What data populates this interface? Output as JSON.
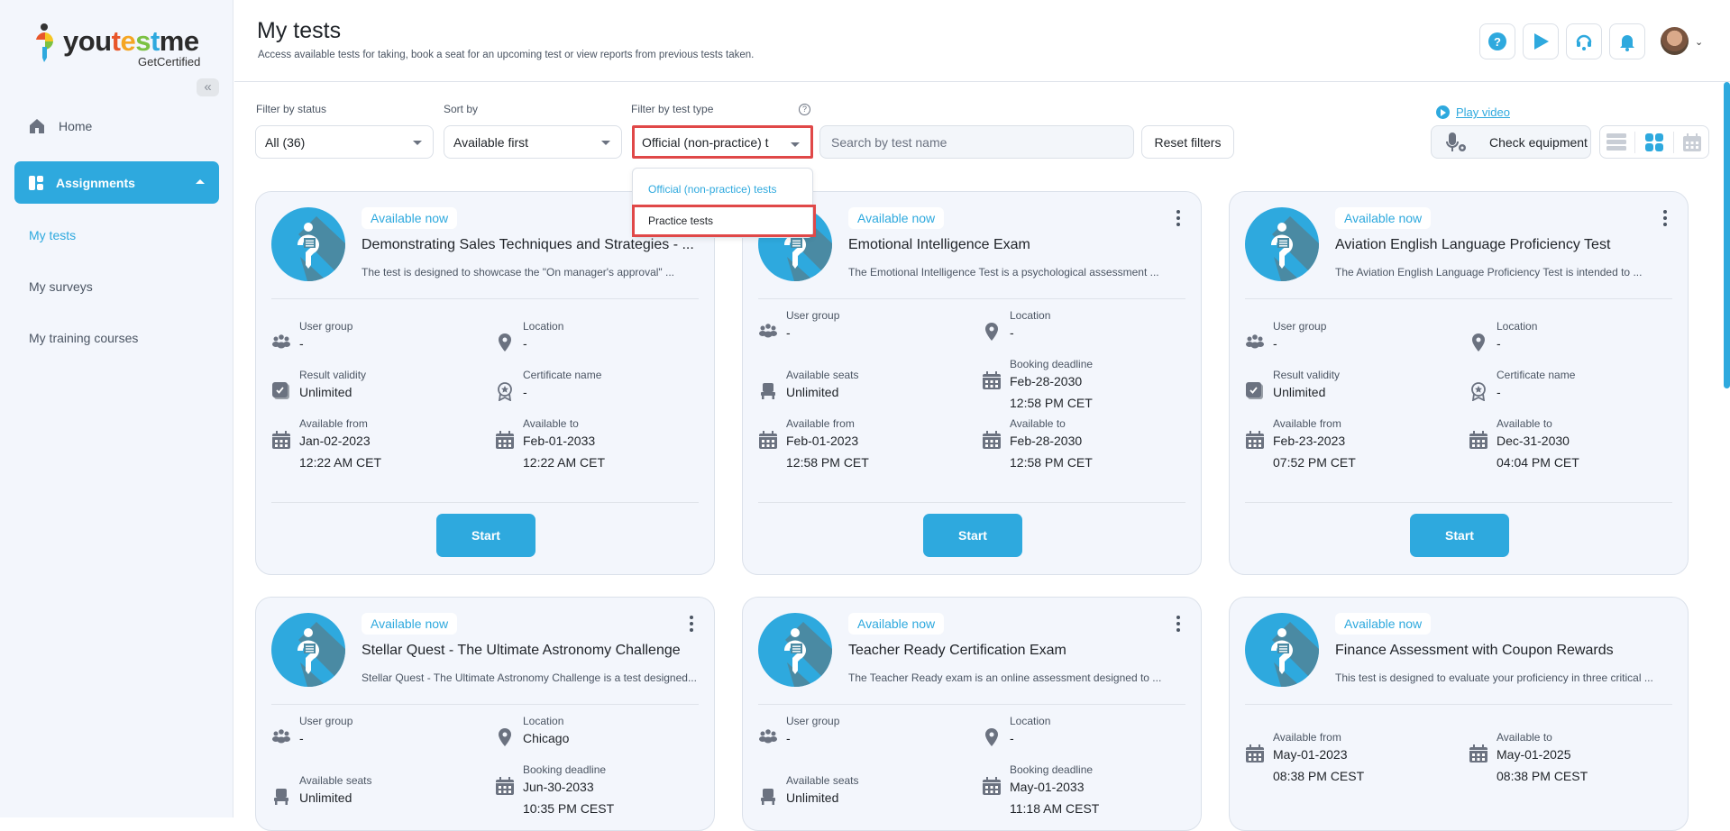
{
  "brand": {
    "word_parts": [
      "you",
      "t",
      "e",
      "s",
      "t",
      "me"
    ],
    "sub": "GetCertified",
    "accent": "#2ea9de",
    "highlight": "#e04848"
  },
  "sidebar": {
    "collapse_icon": "double-chevron-left-icon",
    "home_label": "Home",
    "assignments_label": "Assignments",
    "items": [
      {
        "label": "My tests",
        "active": true
      },
      {
        "label": "My surveys",
        "active": false
      },
      {
        "label": "My training courses",
        "active": false
      }
    ]
  },
  "header": {
    "title": "My tests",
    "subtitle": "Access available tests for taking, book a seat for an upcoming test or view reports from previous tests taken.",
    "icons": [
      "help-icon",
      "play-icon",
      "headset-icon",
      "bell-icon"
    ],
    "user_menu_caret": "⌄"
  },
  "filters": {
    "status_label": "Filter by status",
    "status_value": "All (36)",
    "sort_label": "Sort by",
    "sort_value": "Available first",
    "type_label": "Filter by test type",
    "type_help": "?",
    "type_value": "Official (non-practice) t",
    "type_options": [
      "Official (non-practice) tests",
      "Practice tests"
    ],
    "search_placeholder": "Search by test name",
    "reset_label": "Reset filters",
    "play_video_label": "Play video",
    "check_equipment_label": "Check equipment",
    "views": [
      "list-view",
      "grid-view",
      "calendar-view"
    ],
    "active_view": "grid-view"
  },
  "cards": [
    {
      "badge": "Available now",
      "title": "Demonstrating Sales Techniques and Strategies - ...",
      "desc": "The test is designed to showcase the \"On manager's approval\" ...",
      "fields": [
        {
          "icon": "users",
          "label": "User group",
          "v1": "-",
          "v2": ""
        },
        {
          "icon": "location",
          "label": "Location",
          "v1": "-",
          "v2": ""
        },
        {
          "icon": "validity",
          "label": "Result validity",
          "v1": "Unlimited",
          "v2": ""
        },
        {
          "icon": "certificate",
          "label": "Certificate name",
          "v1": "-",
          "v2": ""
        },
        {
          "icon": "calendar",
          "label": "Available from",
          "v1": "Jan-02-2023",
          "v2": "12:22 AM CET"
        },
        {
          "icon": "calendar",
          "label": "Available to",
          "v1": "Feb-01-2033",
          "v2": "12:22 AM CET"
        }
      ],
      "start": "Start",
      "has_menu": false
    },
    {
      "badge": "Available now",
      "title": "Emotional Intelligence Exam",
      "desc": "The Emotional Intelligence Test is a psychological assessment ...",
      "fields": [
        {
          "icon": "users",
          "label": "User group",
          "v1": "-",
          "v2": ""
        },
        {
          "icon": "location",
          "label": "Location",
          "v1": "-",
          "v2": ""
        },
        {
          "icon": "seat",
          "label": "Available seats",
          "v1": "Unlimited",
          "v2": ""
        },
        {
          "icon": "calendar",
          "label": "Booking deadline",
          "v1": "Feb-28-2030",
          "v2": "12:58 PM CET"
        },
        {
          "icon": "calendar",
          "label": "Available from",
          "v1": "Feb-01-2023",
          "v2": "12:58 PM CET"
        },
        {
          "icon": "calendar",
          "label": "Available to",
          "v1": "Feb-28-2030",
          "v2": "12:58 PM CET"
        }
      ],
      "start": "Start",
      "has_menu": true
    },
    {
      "badge": "Available now",
      "title": "Aviation English Language Proficiency Test",
      "desc": "The Aviation English Language Proficiency Test is intended to ...",
      "fields": [
        {
          "icon": "users",
          "label": "User group",
          "v1": "-",
          "v2": ""
        },
        {
          "icon": "location",
          "label": "Location",
          "v1": "-",
          "v2": ""
        },
        {
          "icon": "validity",
          "label": "Result validity",
          "v1": "Unlimited",
          "v2": ""
        },
        {
          "icon": "certificate",
          "label": "Certificate name",
          "v1": "-",
          "v2": ""
        },
        {
          "icon": "calendar",
          "label": "Available from",
          "v1": "Feb-23-2023",
          "v2": "07:52 PM CET"
        },
        {
          "icon": "calendar",
          "label": "Available to",
          "v1": "Dec-31-2030",
          "v2": "04:04 PM CET"
        }
      ],
      "start": "Start",
      "has_menu": true
    },
    {
      "badge": "Available now",
      "title": "Stellar Quest - The Ultimate Astronomy Challenge",
      "desc": "Stellar Quest - The Ultimate Astronomy Challenge is a test designed...",
      "fields": [
        {
          "icon": "users",
          "label": "User group",
          "v1": "-",
          "v2": ""
        },
        {
          "icon": "location",
          "label": "Location",
          "v1": "Chicago",
          "v2": ""
        },
        {
          "icon": "seat",
          "label": "Available seats",
          "v1": "Unlimited",
          "v2": ""
        },
        {
          "icon": "calendar",
          "label": "Booking deadline",
          "v1": "Jun-30-2033",
          "v2": "10:35 PM CEST"
        }
      ],
      "start": "",
      "has_menu": true
    },
    {
      "badge": "Available now",
      "title": "Teacher Ready Certification Exam",
      "desc": "The Teacher Ready exam is an online assessment designed to ...",
      "fields": [
        {
          "icon": "users",
          "label": "User group",
          "v1": "-",
          "v2": ""
        },
        {
          "icon": "location",
          "label": "Location",
          "v1": "-",
          "v2": ""
        },
        {
          "icon": "seat",
          "label": "Available seats",
          "v1": "Unlimited",
          "v2": ""
        },
        {
          "icon": "calendar",
          "label": "Booking deadline",
          "v1": "May-01-2033",
          "v2": "11:18 AM CEST"
        }
      ],
      "start": "",
      "has_menu": true
    },
    {
      "badge": "Available now",
      "title": "Finance Assessment with Coupon Rewards",
      "desc": "This test is designed to evaluate your proficiency in three critical ...",
      "fields": [
        {
          "icon": "calendar",
          "label": "Available from",
          "v1": "May-01-2023",
          "v2": "08:38 PM CEST"
        },
        {
          "icon": "calendar",
          "label": "Available to",
          "v1": "May-01-2025",
          "v2": "08:38 PM CEST"
        }
      ],
      "start": "",
      "has_menu": false
    }
  ]
}
